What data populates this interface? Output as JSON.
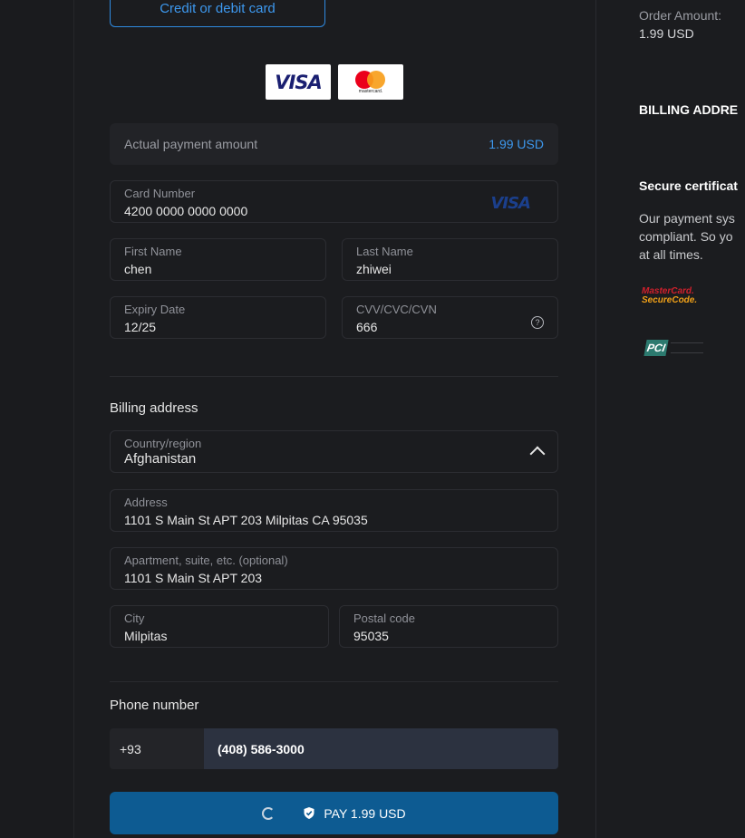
{
  "payment_method": {
    "label": "Credit or debit card"
  },
  "card_logos": {
    "visa": "VISA",
    "mastercard_caption": "mastercard."
  },
  "amount": {
    "label": "Actual payment amount",
    "value": "1.99 USD"
  },
  "card": {
    "number_label": "Card Number",
    "number_value": "4200 0000 0000 0000",
    "brand": "VISA",
    "first_name_label": "First Name",
    "first_name_value": "chen",
    "last_name_label": "Last Name",
    "last_name_value": "zhiwei",
    "expiry_label": "Expiry Date",
    "expiry_value": "12/25",
    "cvv_label": "CVV/CVC/CVN",
    "cvv_value": "666",
    "cvv_help": "?"
  },
  "billing": {
    "title": "Billing address",
    "country_label": "Country/region",
    "country_value": "Afghanistan",
    "address_label": "Address",
    "address_value": "1101 S Main St APT 203 Milpitas CA 95035",
    "apartment_label": "Apartment, suite, etc. (optional)",
    "apartment_value": "1101 S Main St APT 203",
    "city_label": "City",
    "city_value": "Milpitas",
    "postal_label": "Postal code",
    "postal_value": "95035"
  },
  "phone": {
    "title": "Phone number",
    "code": "+93",
    "number": "(408) 586-3000"
  },
  "pay_button": {
    "label": "PAY 1.99 USD"
  },
  "sidebar": {
    "order_amount_label": "Order Amount:",
    "order_amount_value": "1.99 USD",
    "billing_address_heading": "BILLING ADDRE",
    "secure_heading": "Secure certificat",
    "secure_text_lines": [
      "Our payment sys",
      "compliant. So yo",
      "at all times."
    ],
    "securecode_line1": "MasterCard.",
    "securecode_line2": "SecureCode.",
    "pci_label": "PCI"
  },
  "colors": {
    "accent": "#3d98ee",
    "pay_button": "#0d5b92",
    "background": "#1b1c1f"
  }
}
